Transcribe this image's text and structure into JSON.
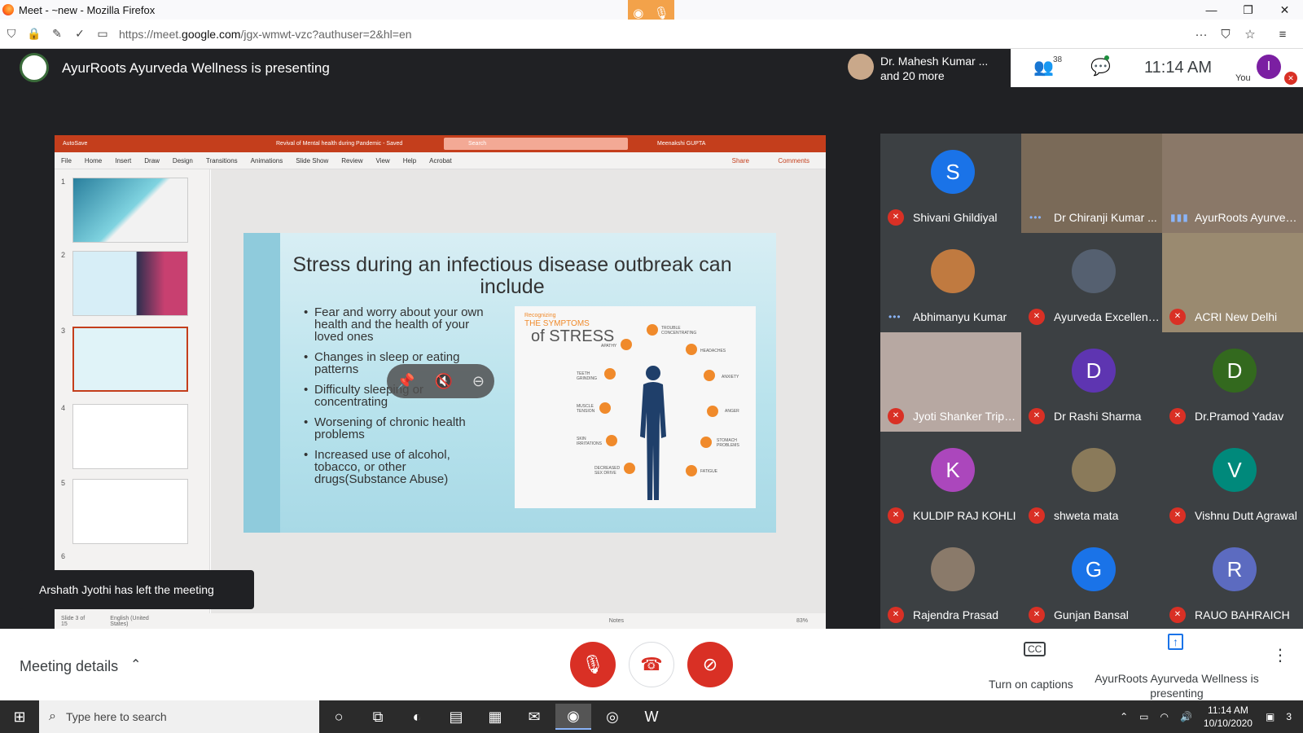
{
  "browser": {
    "window_title": "Meet - ~new - Mozilla Firefox",
    "url_prefix": "https://meet.",
    "url_domain": "google.com",
    "url_rest": "/jgx-wmwt-vzc?authuser=2&hl=en"
  },
  "meet_header": {
    "presenting_title": "AyurRoots Ayurveda Wellness is presenting",
    "active_speakers_line1": "Dr. Mahesh Kumar ...",
    "active_speakers_line2": "and 20 more",
    "people_count": "38",
    "time": "11:14 AM",
    "you_initial": "I",
    "you_label": "You"
  },
  "powerpoint": {
    "autosave_label": "AutoSave",
    "doc_title": "Revival of Mental health during Pandemic  -  Saved",
    "search_placeholder": "Search",
    "user_name": "Meenakshi GUPTA",
    "menu": [
      "File",
      "Home",
      "Insert",
      "Draw",
      "Design",
      "Transitions",
      "Animations",
      "Slide Show",
      "Review",
      "View",
      "Help",
      "Acrobat"
    ],
    "share_label": "Share",
    "comments_label": "Comments",
    "thumb_numbers": [
      "1",
      "2",
      "3",
      "4",
      "5",
      "6"
    ],
    "status": {
      "slide_of": "Slide 3 of 15",
      "language": "English (United States)",
      "notes": "Notes",
      "zoom": "83%"
    },
    "slide": {
      "title": "Stress during an infectious disease outbreak can include",
      "bullets": [
        "Fear and worry about your own health and the health of your loved ones",
        "Changes in sleep or eating patterns",
        "Difficulty sleeping or concentrating",
        "Worsening of chronic health problems",
        "Increased use of alcohol, tobacco, or other drugs(Substance Abuse)"
      ],
      "infographic": {
        "recognizing": "Recognizing",
        "symptoms_of": "THE SYMPTOMS",
        "stress": "of STRESS",
        "labels": [
          "APATHY",
          "TROUBLE CONCENTRATING",
          "HEADACHES",
          "TEETH GRINDING",
          "ANXIETY",
          "MUSCLE TENSION",
          "ANGER",
          "SKIN IRRITATIONS",
          "STOMACH PROBLEMS",
          "DECREASED SEX DRIVE",
          "FATIGUE"
        ]
      }
    }
  },
  "toast": "Arshath Jyothi has left the meeting",
  "participants": [
    {
      "name": "Shivani Ghildiyal",
      "initial": "S",
      "color": "#1a73e8",
      "muted": true
    },
    {
      "name": "Dr Chiranji Kumar ...",
      "initial": "",
      "color": "#7a6a58",
      "muted": false
    },
    {
      "name": "AyurRoots Ayurved...",
      "initial": "",
      "color": "#8a7868",
      "muted": false
    },
    {
      "name": "Abhimanyu Kumar",
      "initial": "",
      "color": "#c07a40",
      "muted": false
    },
    {
      "name": "Ayurveda Excellence",
      "initial": "",
      "color": "#556070",
      "muted": true
    },
    {
      "name": "ACRI New Delhi",
      "initial": "",
      "color": "#9a8a70",
      "muted": true
    },
    {
      "name": "Jyoti Shanker Tripa...",
      "initial": "",
      "color": "#b7a8a2",
      "muted": true
    },
    {
      "name": "Dr Rashi Sharma",
      "initial": "D",
      "color": "#5e35b1",
      "muted": true
    },
    {
      "name": "Dr.Pramod Yadav",
      "initial": "D",
      "color": "#33691e",
      "muted": true
    },
    {
      "name": "KULDIP RAJ KOHLI",
      "initial": "K",
      "color": "#ab47bc",
      "muted": true
    },
    {
      "name": "shweta mata",
      "initial": "",
      "color": "#8a7a5a",
      "muted": true
    },
    {
      "name": "Vishnu Dutt Agrawal",
      "initial": "V",
      "color": "#00897b",
      "muted": true
    },
    {
      "name": "Rajendra Prasad",
      "initial": "",
      "color": "#8a7a6a",
      "muted": true
    },
    {
      "name": "Gunjan Bansal",
      "initial": "G",
      "color": "#1a73e8",
      "muted": true
    },
    {
      "name": "RAUO BAHRAICH",
      "initial": "R",
      "color": "#5c6bc0",
      "muted": true
    }
  ],
  "bottom_bar": {
    "meeting_details": "Meeting details",
    "captions_label": "Turn on captions",
    "presenting_label": "AyurRoots Ayurveda Wellness is presenting"
  },
  "taskbar": {
    "search_placeholder": "Type here to search",
    "time": "11:14 AM",
    "date": "10/10/2020",
    "notification_count": "3"
  }
}
